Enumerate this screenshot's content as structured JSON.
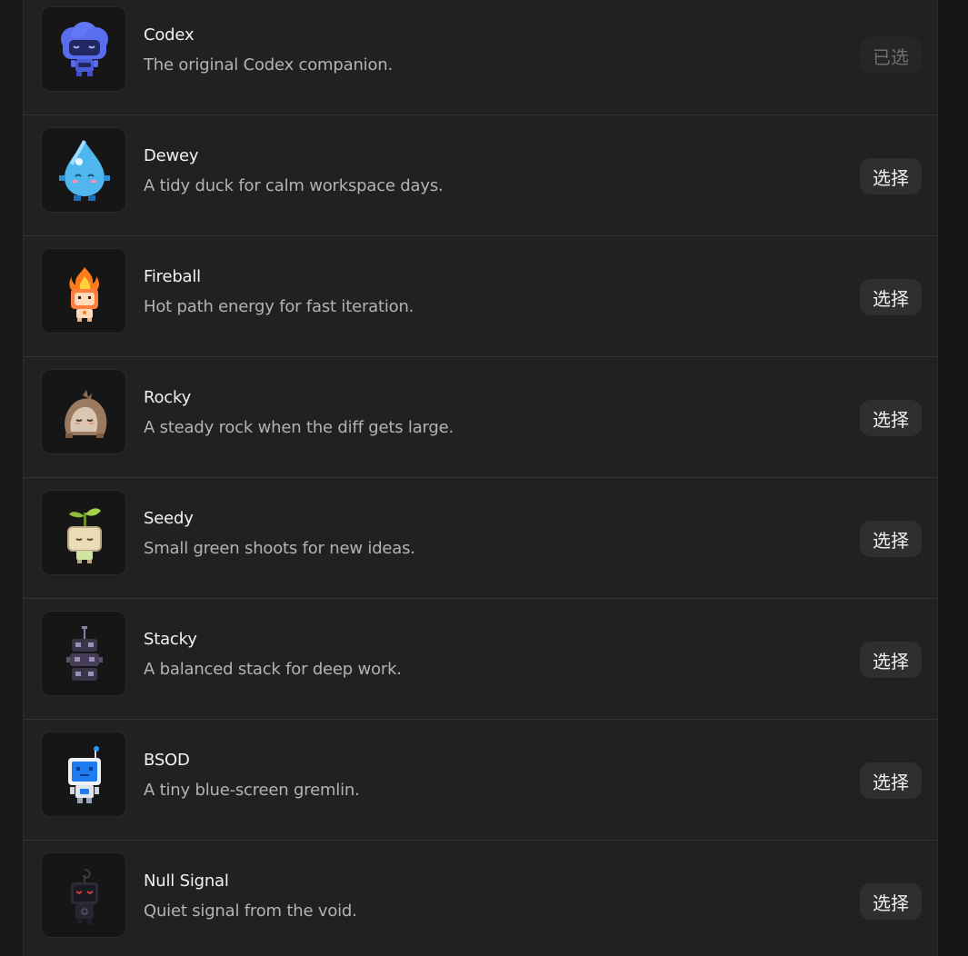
{
  "companions": [
    {
      "name": "Codex",
      "description": "The original Codex companion.",
      "button": "已选",
      "selected": true,
      "icon": "codex-cloud-robot-icon"
    },
    {
      "name": "Dewey",
      "description": "A tidy duck for calm workspace days.",
      "button": "选择",
      "selected": false,
      "icon": "water-drop-icon"
    },
    {
      "name": "Fireball",
      "description": "Hot path energy for fast iteration.",
      "button": "选择",
      "selected": false,
      "icon": "fireball-icon"
    },
    {
      "name": "Rocky",
      "description": "A steady rock when the diff gets large.",
      "button": "选择",
      "selected": false,
      "icon": "rock-icon"
    },
    {
      "name": "Seedy",
      "description": "Small green shoots for new ideas.",
      "button": "选择",
      "selected": false,
      "icon": "sprout-icon"
    },
    {
      "name": "Stacky",
      "description": "A balanced stack for deep work.",
      "button": "选择",
      "selected": false,
      "icon": "stack-robot-icon"
    },
    {
      "name": "BSOD",
      "description": "A tiny blue-screen gremlin.",
      "button": "选择",
      "selected": false,
      "icon": "blue-screen-robot-icon"
    },
    {
      "name": "Null Signal",
      "description": "Quiet signal from the void.",
      "button": "选择",
      "selected": false,
      "icon": "dark-robot-icon"
    }
  ]
}
